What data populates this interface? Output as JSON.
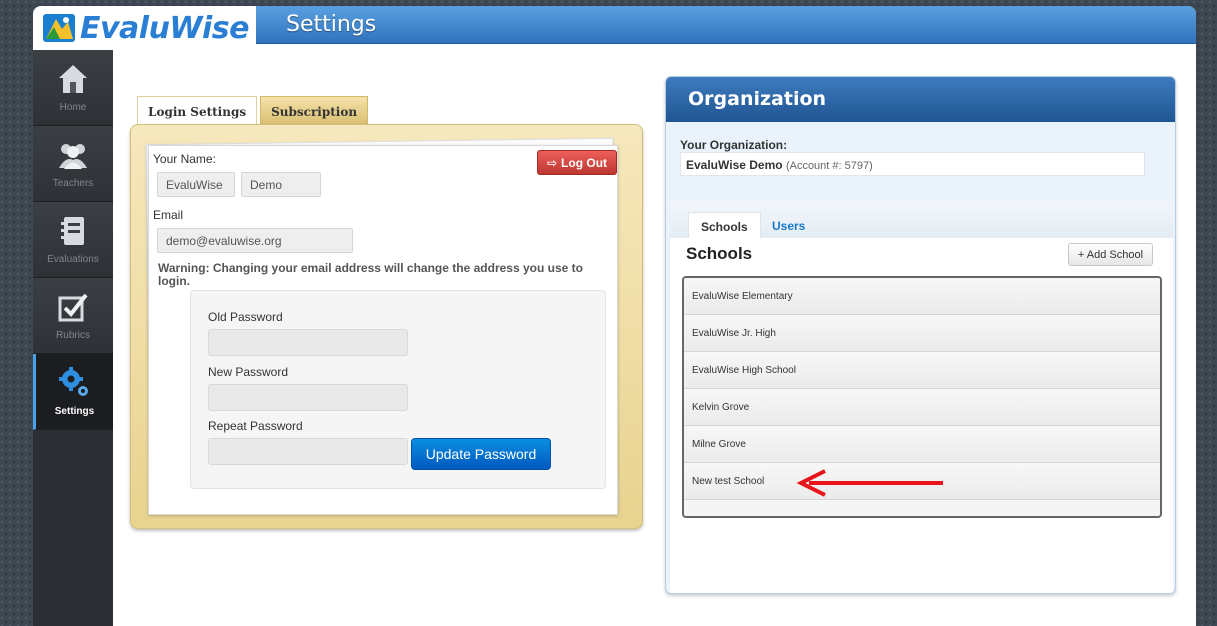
{
  "app": {
    "name": "EvaluWise",
    "page_title": "Settings"
  },
  "sidebar": {
    "items": [
      {
        "label": "Home",
        "icon": "home-icon"
      },
      {
        "label": "Teachers",
        "icon": "teachers-icon"
      },
      {
        "label": "Evaluations",
        "icon": "evaluations-icon"
      },
      {
        "label": "Rubrics",
        "icon": "rubrics-icon"
      },
      {
        "label": "Settings",
        "icon": "settings-icon",
        "active": true
      }
    ]
  },
  "login_tabs": [
    {
      "label": "Login Settings",
      "active": true
    },
    {
      "label": "Subscription",
      "active": false
    }
  ],
  "login": {
    "name_label": "Your Name:",
    "first_name": "EvaluWise",
    "last_name": "Demo",
    "logout_label": "Log Out",
    "email_label": "Email",
    "email": "demo@evaluwise.org",
    "warning": "Warning: Changing your email address will change the address you use to login.",
    "old_password_label": "Old Password",
    "new_password_label": "New Password",
    "repeat_password_label": "Repeat Password",
    "update_label": "Update Password"
  },
  "organization": {
    "title": "Organization",
    "your_org_label": "Your Organization:",
    "org_name": "EvaluWise Demo",
    "account": "(Account #: 5797)",
    "tabs": [
      {
        "label": "Schools",
        "active": true
      },
      {
        "label": "Users",
        "active": false
      }
    ],
    "schools_title": "Schools",
    "add_school_label": "+ Add School",
    "schools": [
      "EvaluWise Elementary",
      "EvaluWise Jr. High",
      "EvaluWise High School",
      "Kelvin Grove",
      "Milne Grove",
      "New test School"
    ]
  },
  "colors": {
    "accent": "#2f73bd",
    "danger": "#bd362f",
    "arrow": "#e8141a"
  }
}
